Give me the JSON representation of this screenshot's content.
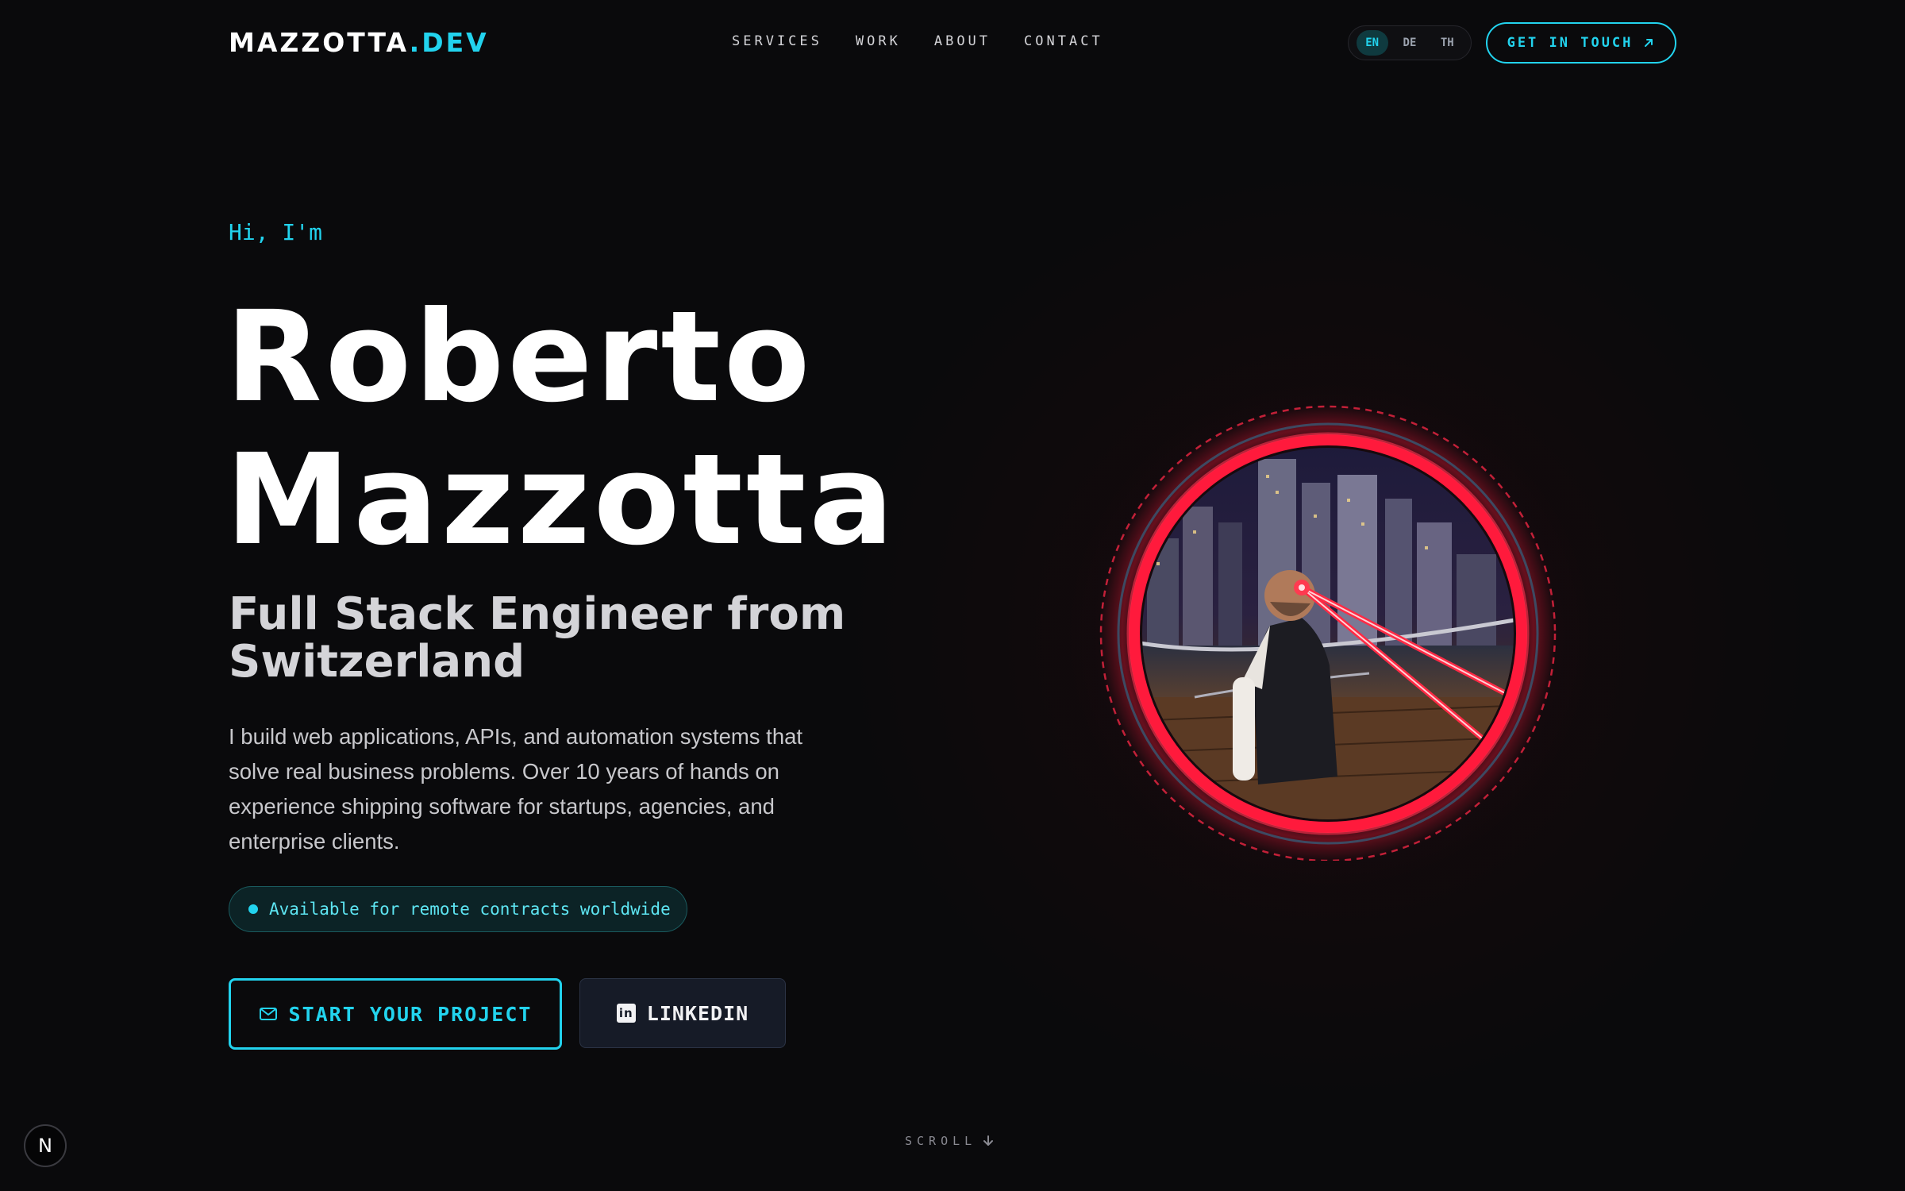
{
  "nav": {
    "logo_main": "MAZZOTTA",
    "logo_accent": ".DEV",
    "links": [
      "SERVICES",
      "WORK",
      "ABOUT",
      "CONTACT"
    ],
    "languages": [
      "EN",
      "DE",
      "TH"
    ],
    "active_language": "EN",
    "cta_label": "GET IN TOUCH",
    "cta_icon": "arrow-up-right-icon"
  },
  "hero": {
    "greeting": "Hi, I'm",
    "name_line1": "Roberto",
    "name_line2": "Mazzotta",
    "role": "Full Stack Engineer from Switzerland",
    "description": "I build web applications, APIs, and automation systems that solve real business problems. Over 10 years of hands on experience shipping software for startups, agencies, and enterprise clients.",
    "availability": "Available for remote contracts worldwide",
    "primary_button": "START YOUR PROJECT",
    "primary_icon": "mail-icon",
    "secondary_button": "LINKEDIN",
    "secondary_icon": "linkedin-icon"
  },
  "footer": {
    "scroll_label": "SCROLL",
    "scroll_icon": "arrow-down-icon",
    "dev_badge": "N"
  },
  "colors": {
    "background": "#0a0a0c",
    "accent": "#22d3ee",
    "glow": "#ff1a3c"
  }
}
